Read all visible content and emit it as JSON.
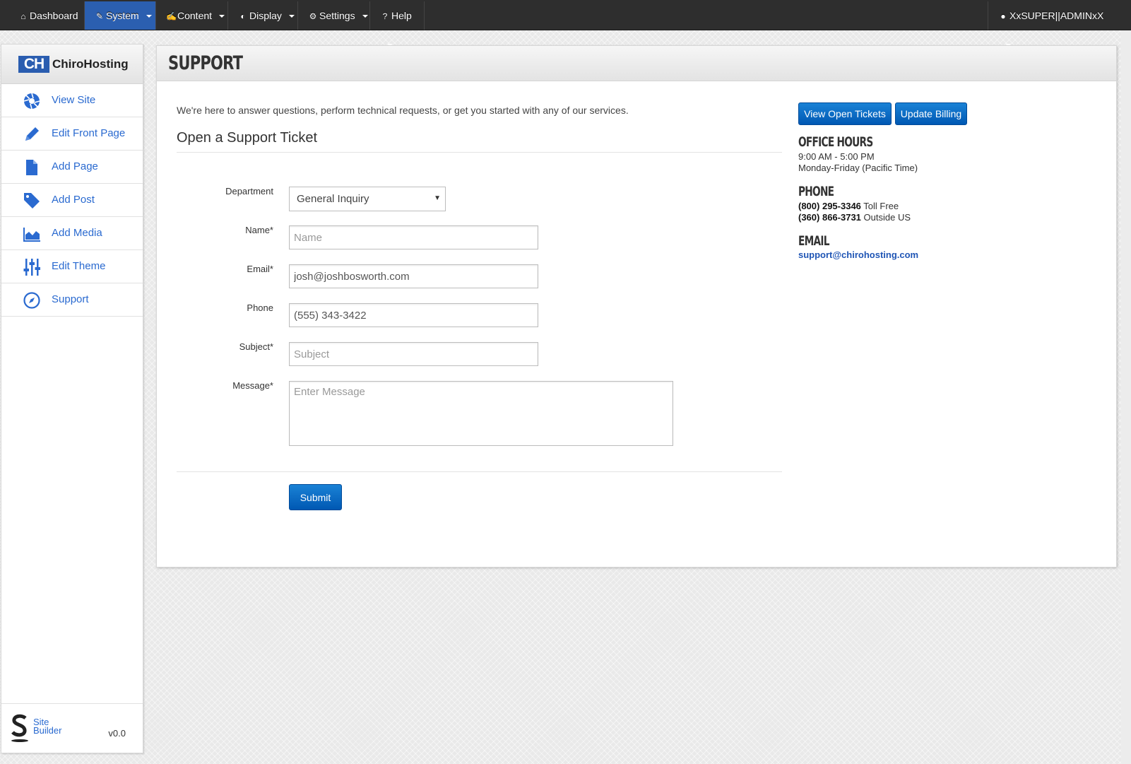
{
  "topnav": {
    "items": [
      {
        "label": "Dashboard",
        "icon": "home-icon",
        "has_caret": false
      },
      {
        "label": "System",
        "icon": "wrench-icon",
        "has_caret": true,
        "active": true
      },
      {
        "label": "Content",
        "icon": "edit-icon",
        "has_caret": true
      },
      {
        "label": "Display",
        "icon": "contrast-icon",
        "has_caret": true
      },
      {
        "label": "Settings",
        "icon": "gear-icon",
        "has_caret": true
      },
      {
        "label": "Help",
        "icon": "question-icon",
        "has_caret": true
      }
    ],
    "user": {
      "label": "XxSUPER||ADMINxX",
      "icon": "user-icon"
    }
  },
  "sidebar": {
    "brand_mark": "CH",
    "brand_name": "ChiroHosting",
    "items": [
      {
        "label": "View Site",
        "icon": "aperture-icon"
      },
      {
        "label": "Edit Front Page",
        "icon": "pencil-icon"
      },
      {
        "label": "Add Page",
        "icon": "page-icon"
      },
      {
        "label": "Add Post",
        "icon": "tag-icon"
      },
      {
        "label": "Add Media",
        "icon": "chart-area-icon"
      },
      {
        "label": "Edit Theme",
        "icon": "sliders-icon"
      },
      {
        "label": "Support",
        "icon": "compass-icon"
      }
    ],
    "footer": {
      "logo_line1": "Site",
      "logo_line2": "Builder",
      "version": "v0.0"
    }
  },
  "main": {
    "title": "SUPPORT",
    "intro": "We're here to answer questions, perform technical requests, or get you started with any of our services.",
    "section_title": "Open a Support Ticket",
    "form": {
      "department_label": "Department",
      "department_value": "General Inquiry",
      "name_label": "Name*",
      "name_placeholder": "Name",
      "email_label": "Email*",
      "email_value": "josh@joshbosworth.com",
      "phone_label": "Phone",
      "phone_value": "(555) 343-3422",
      "subject_label": "Subject*",
      "subject_placeholder": "Subject",
      "message_label": "Message*",
      "message_placeholder": "Enter Message",
      "submit_label": "Submit"
    },
    "aside": {
      "view_tickets_label": "View Open Tickets",
      "update_billing_label": "Update Billing",
      "office_hours_heading": "OFFICE HOURS",
      "office_hours_line1": "9:00 AM - 5:00 PM",
      "office_hours_line2": "Monday-Friday (Pacific Time)",
      "phone_heading": "PHONE",
      "phone_tollfree_number": "(800) 295-3346",
      "phone_tollfree_label": "Toll Free",
      "phone_outside_number": "(360) 866-3731",
      "phone_outside_label": "Outside US",
      "email_heading": "EMAIL",
      "email_address": "support@chirohosting.com"
    }
  },
  "colors": {
    "nav_bg": "#2e2e2e",
    "nav_active": "#2b5fb0",
    "link_blue": "#2a6ad0",
    "button_blue": "#0a6fcc"
  }
}
